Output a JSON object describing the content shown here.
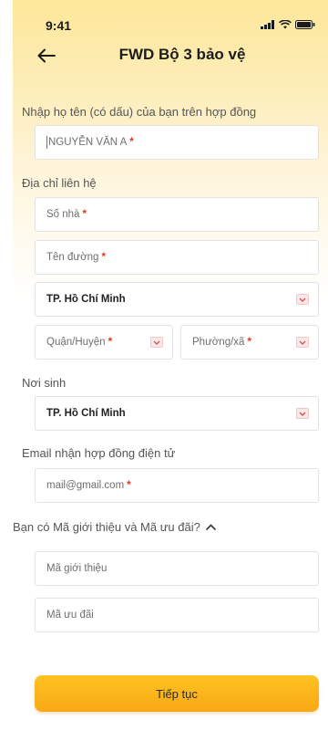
{
  "status_bar": {
    "time": "9:41"
  },
  "header": {
    "title": "FWD Bộ 3 bảo vệ"
  },
  "form": {
    "name_label": "Nhập họ tên (có dấu) của bạn trên hợp đồng",
    "name_placeholder": "NGUYỄN VĂN A",
    "required_mark": "*",
    "address_label": "Địa chỉ liên hệ",
    "house_number_placeholder": "Số nhà",
    "street_placeholder": "Tên đường",
    "city_value": "TP. Hồ Chí Minh",
    "district_placeholder": "Quận/Huyện",
    "ward_placeholder": "Phường/xã",
    "birthplace_label": "Nơi sinh",
    "birthplace_value": "TP. Hồ Chí Minh",
    "email_label": "Email nhận hợp đồng điện tử",
    "email_placeholder": "mail@gmail.com",
    "promo_toggle_label": "Bạn có Mã giới thiệu và Mã ưu đãi?",
    "referral_placeholder": "Mã giới thiệu",
    "discount_placeholder": "Mã ưu đãi"
  },
  "actions": {
    "continue_label": "Tiếp tục"
  },
  "colors": {
    "accent": "#fbb81c",
    "required": "#e8331b",
    "header_gradient_top": "#fde79a"
  },
  "icons": {
    "back": "arrow-left-icon",
    "dropdown": "chevron-down-icon",
    "collapse": "chevron-up-icon",
    "signal": "signal-icon",
    "wifi": "wifi-icon",
    "battery": "battery-icon"
  }
}
